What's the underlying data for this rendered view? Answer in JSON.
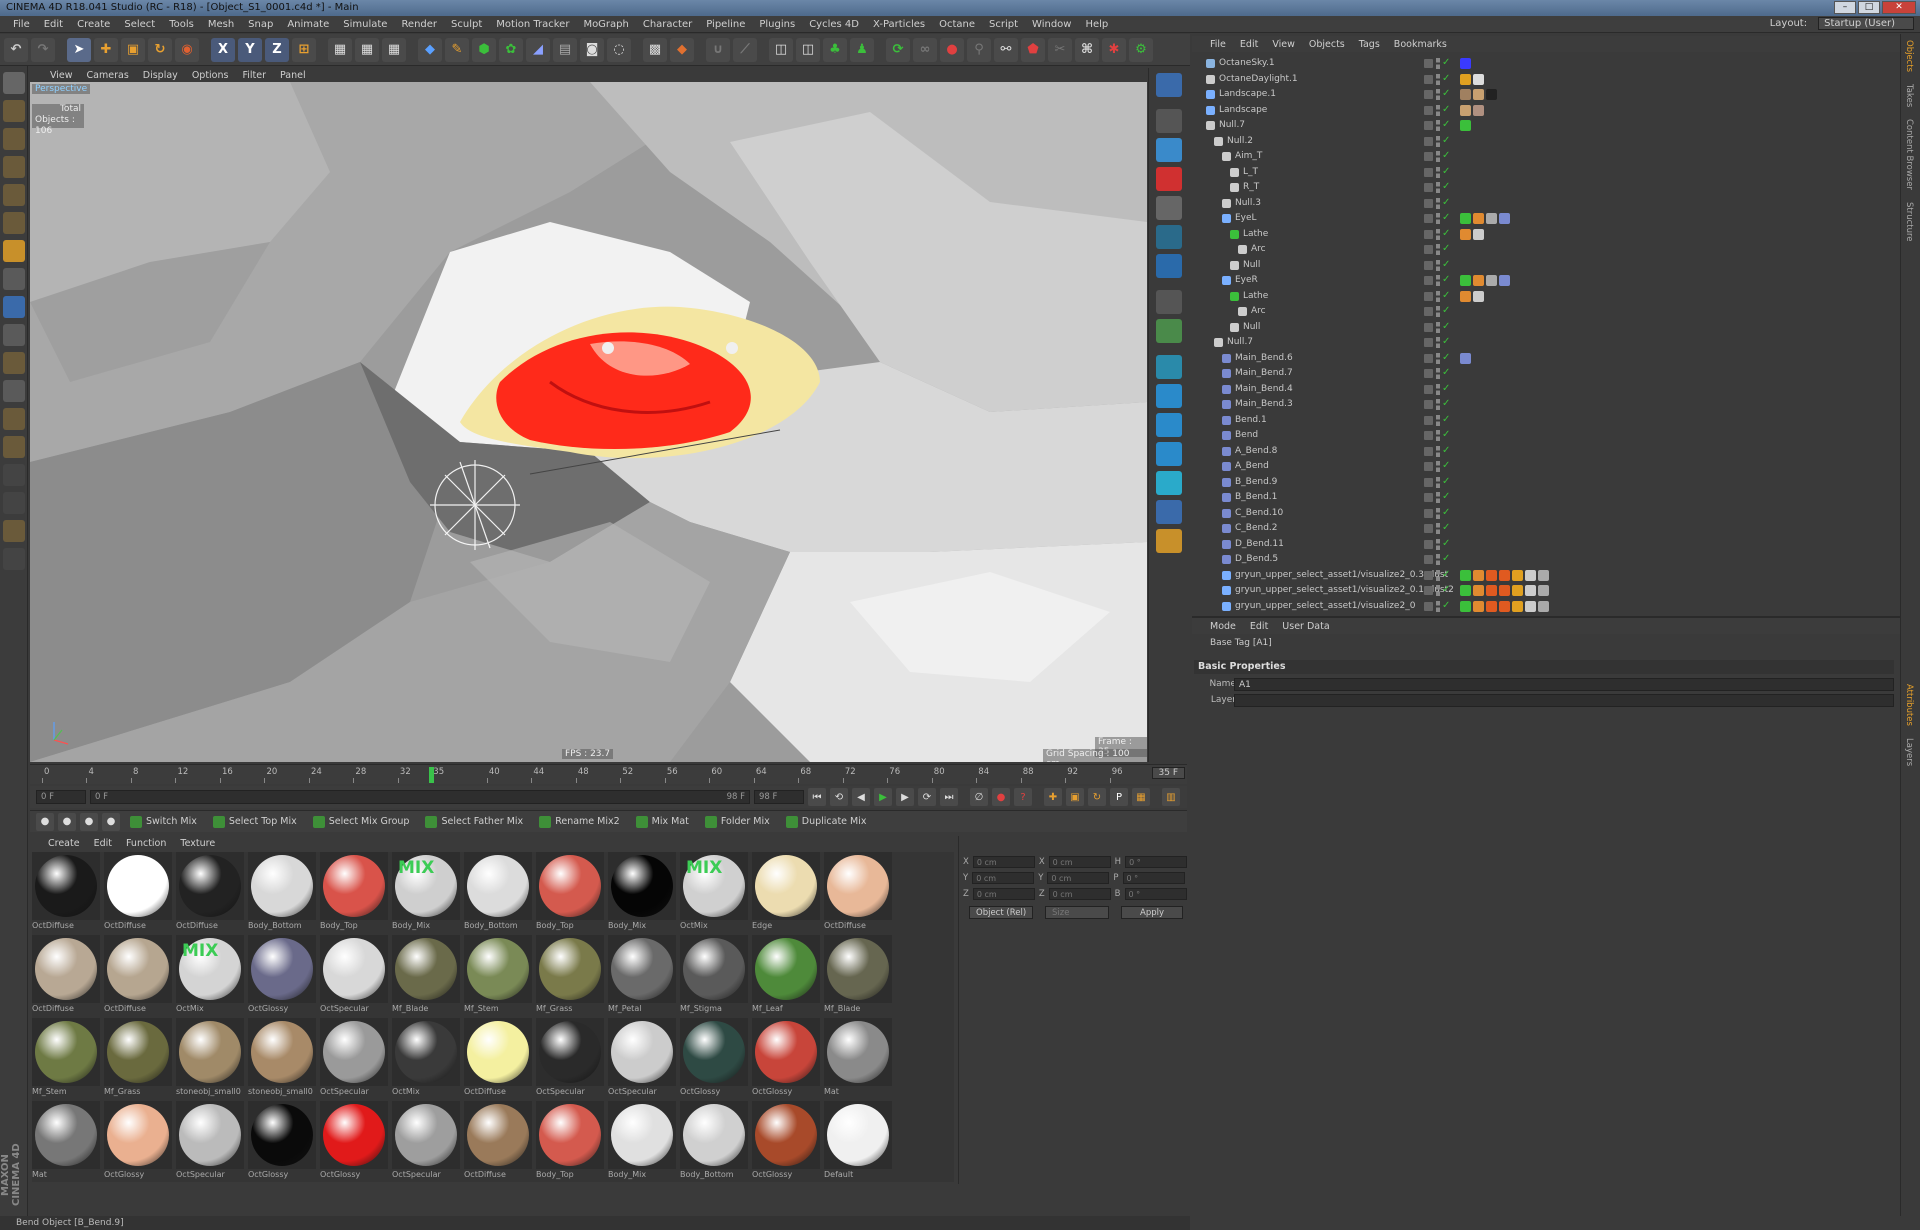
{
  "window": {
    "title": "CINEMA 4D R18.041 Studio (RC - R18) - [Object_S1_0001.c4d *] - Main"
  },
  "menubar": {
    "items": [
      "File",
      "Edit",
      "Create",
      "Select",
      "Tools",
      "Mesh",
      "Snap",
      "Animate",
      "Simulate",
      "Render",
      "Sculpt",
      "Motion Tracker",
      "MoGraph",
      "Character",
      "Pipeline",
      "Plugins",
      "Cycles 4D",
      "X-Particles",
      "Octane",
      "Script",
      "Window",
      "Help"
    ],
    "layout_label": "Layout:",
    "layout_value": "Startup (User)"
  },
  "viewport": {
    "menu": [
      "View",
      "Cameras",
      "Display",
      "Options",
      "Filter",
      "Panel"
    ],
    "camera_label": "Perspective",
    "stats_total": "Total",
    "stats_objects": "Objects : 106",
    "fps": "FPS : 23.7",
    "frame": "Frame : 35",
    "grid_spacing": "Grid Spacing : 100 cm"
  },
  "timeline": {
    "ticks": [
      "0",
      "4",
      "8",
      "12",
      "16",
      "20",
      "24",
      "28",
      "32",
      "35",
      "40",
      "44",
      "48",
      "52",
      "56",
      "60",
      "64",
      "68",
      "72",
      "76",
      "80",
      "84",
      "88",
      "92",
      "96"
    ],
    "current_frame": "35",
    "end_field": "35 F"
  },
  "transport": {
    "start_field": "0 F",
    "range_start": "0 F",
    "range_end": "98 F",
    "end_field": "98 F"
  },
  "mixbar": {
    "buttons": [
      "Switch Mix",
      "Select Top Mix",
      "Select Mix Group",
      "Select Father Mix",
      "Rename Mix2",
      "Mix Mat",
      "Folder Mix",
      "Duplicate Mix"
    ]
  },
  "material_manager": {
    "menu": [
      "Create",
      "Edit",
      "Function",
      "Texture"
    ],
    "materials": [
      {
        "name": "OctDiffuse",
        "color": "#1a1a1a",
        "mix": ""
      },
      {
        "name": "OctDiffuse",
        "color": "#ffffff",
        "mix": ""
      },
      {
        "name": "OctDiffuse",
        "color": "#222222",
        "mix": ""
      },
      {
        "name": "Body_Bottom",
        "color": "#d8d8d8",
        "mix": ""
      },
      {
        "name": "Body_Top",
        "color": "#d9534a",
        "mix": ""
      },
      {
        "name": "Body_Mix",
        "color": "#cfcfcf",
        "mix": "MIX"
      },
      {
        "name": "Body_Bottom",
        "color": "#dcdcdc",
        "mix": ""
      },
      {
        "name": "Body_Top",
        "color": "#d45a4e",
        "mix": ""
      },
      {
        "name": "Body_Mix",
        "color": "#050505",
        "mix": ""
      },
      {
        "name": "OctMix",
        "color": "#d0d0d0",
        "mix": "MIX"
      },
      {
        "name": "Edge",
        "color": "#ecdcb0",
        "mix": ""
      },
      {
        "name": "OctDiffuse",
        "color": "#e8b898",
        "mix": ""
      },
      {
        "name": "OctDiffuse",
        "color": "#b8a894",
        "mix": ""
      },
      {
        "name": "OctDiffuse",
        "color": "#b6a690",
        "mix": ""
      },
      {
        "name": "OctMix",
        "color": "#d4d4d4",
        "mix": "MIX"
      },
      {
        "name": "OctGlossy",
        "color": "#6a6a8a",
        "mix": ""
      },
      {
        "name": "OctSpecular",
        "color": "#d8d8d8",
        "mix": ""
      },
      {
        "name": "Mf_Blade",
        "color": "#6a6a4a",
        "mix": ""
      },
      {
        "name": "Mf_Stem",
        "color": "#7a8a56",
        "mix": ""
      },
      {
        "name": "Mf_Grass",
        "color": "#7a7a4a",
        "mix": ""
      },
      {
        "name": "Mf_Petal",
        "color": "#6a6a6a",
        "mix": ""
      },
      {
        "name": "Mf_Stigma",
        "color": "#5a5a5a",
        "mix": ""
      },
      {
        "name": "Mf_Leaf",
        "color": "#4e8a3a",
        "mix": ""
      },
      {
        "name": "Mf_Blade",
        "color": "#666650",
        "mix": ""
      },
      {
        "name": "Mf_Stem",
        "color": "#6e7a44",
        "mix": ""
      },
      {
        "name": "Mf_Grass",
        "color": "#6a6a3e",
        "mix": ""
      },
      {
        "name": "stoneobj_small0",
        "color": "#a08a68",
        "mix": ""
      },
      {
        "name": "stoneobj_small0",
        "color": "#a88a68",
        "mix": ""
      },
      {
        "name": "OctSpecular",
        "color": "#9a9a9a",
        "mix": ""
      },
      {
        "name": "OctMix",
        "color": "#3a3a3a",
        "mix": ""
      },
      {
        "name": "OctDiffuse",
        "color": "#f4f0a0",
        "mix": ""
      },
      {
        "name": "OctSpecular",
        "color": "#2a2a2a",
        "mix": ""
      },
      {
        "name": "OctSpecular",
        "color": "#cccccc",
        "mix": ""
      },
      {
        "name": "OctGlossy",
        "color": "#2e4a44",
        "mix": ""
      },
      {
        "name": "OctGlossy",
        "color": "#c8453a",
        "mix": ""
      },
      {
        "name": "Mat",
        "color": "#8a8a8a",
        "mix": ""
      },
      {
        "name": "Mat",
        "color": "#777777",
        "mix": ""
      },
      {
        "name": "OctGlossy",
        "color": "#eab090",
        "mix": ""
      },
      {
        "name": "OctSpecular",
        "color": "#bbbbbb",
        "mix": ""
      },
      {
        "name": "OctGlossy",
        "color": "#0a0a0a",
        "mix": ""
      },
      {
        "name": "OctGlossy",
        "color": "#e11a1a",
        "mix": ""
      },
      {
        "name": "OctSpecular",
        "color": "#9e9e9e",
        "mix": ""
      },
      {
        "name": "OctDiffuse",
        "color": "#9a7a5a",
        "mix": ""
      },
      {
        "name": "Body_Top",
        "color": "#d45a4e",
        "mix": ""
      },
      {
        "name": "Body_Mix",
        "color": "#e0e0e0",
        "mix": ""
      },
      {
        "name": "Body_Bottom",
        "color": "#d0d0d0",
        "mix": ""
      },
      {
        "name": "OctGlossy",
        "color": "#a84a2a",
        "mix": ""
      },
      {
        "name": "Default",
        "color": "#f0f0f0",
        "mix": ""
      }
    ]
  },
  "coords": {
    "rows": [
      {
        "a": "X",
        "av": "0 cm",
        "b": "X",
        "bv": "0 cm",
        "c": "H",
        "cv": "0 °"
      },
      {
        "a": "Y",
        "av": "0 cm",
        "b": "Y",
        "bv": "0 cm",
        "c": "P",
        "cv": "0 °"
      },
      {
        "a": "Z",
        "av": "0 cm",
        "b": "Z",
        "bv": "0 cm",
        "c": "B",
        "cv": "0 °"
      }
    ],
    "mode": "Object (Rel)",
    "size_mode": "Size",
    "apply": "Apply"
  },
  "object_manager": {
    "menu": [
      "File",
      "Edit",
      "View",
      "Objects",
      "Tags",
      "Bookmarks"
    ],
    "rows": [
      {
        "name": "OctaneSky.1",
        "indent": 0,
        "icon": "#8ab4e0",
        "tags": [
          "#3a3aff"
        ]
      },
      {
        "name": "OctaneDaylight.1",
        "indent": 0,
        "icon": "#cccccc",
        "tags": [
          "#e0a020",
          "#dddddd"
        ]
      },
      {
        "name": "Landscape.1",
        "indent": 0,
        "icon": "#7ab0ff",
        "tags": [
          "#a08060",
          "#c8a070",
          "#222222"
        ]
      },
      {
        "name": "Landscape",
        "indent": 0,
        "icon": "#7ab0ff",
        "tags": [
          "#c8a070",
          "#b09080"
        ]
      },
      {
        "name": "Null.7",
        "indent": 0,
        "icon": "#cccccc",
        "tags": [
          "#3bbf3b"
        ]
      },
      {
        "name": "Null.2",
        "indent": 1,
        "icon": "#cccccc",
        "tags": []
      },
      {
        "name": "Aim_T",
        "indent": 2,
        "icon": "#cccccc",
        "tags": []
      },
      {
        "name": "L_T",
        "indent": 3,
        "icon": "#cccccc",
        "tags": []
      },
      {
        "name": "R_T",
        "indent": 3,
        "icon": "#cccccc",
        "tags": []
      },
      {
        "name": "Null.3",
        "indent": 2,
        "icon": "#cccccc",
        "tags": []
      },
      {
        "name": "EyeL",
        "indent": 2,
        "icon": "#7ab0ff",
        "tags": [
          "#3bbf3b",
          "#e08a30",
          "#aaaaaa",
          "#7a8ad0"
        ]
      },
      {
        "name": "Lathe",
        "indent": 3,
        "icon": "#3bbf3b",
        "tags": [
          "#e08a30",
          "#cccccc"
        ]
      },
      {
        "name": "Arc",
        "indent": 4,
        "icon": "#cccccc",
        "tags": []
      },
      {
        "name": "Null",
        "indent": 3,
        "icon": "#cccccc",
        "tags": []
      },
      {
        "name": "EyeR",
        "indent": 2,
        "icon": "#7ab0ff",
        "tags": [
          "#3bbf3b",
          "#e08a30",
          "#aaaaaa",
          "#7a8ad0"
        ]
      },
      {
        "name": "Lathe",
        "indent": 3,
        "icon": "#3bbf3b",
        "tags": [
          "#e08a30",
          "#cccccc"
        ]
      },
      {
        "name": "Arc",
        "indent": 4,
        "icon": "#cccccc",
        "tags": []
      },
      {
        "name": "Null",
        "indent": 3,
        "icon": "#cccccc",
        "tags": []
      },
      {
        "name": "Null.7",
        "indent": 1,
        "icon": "#cccccc",
        "tags": []
      },
      {
        "name": "Main_Bend.6",
        "indent": 2,
        "icon": "#7a8ad0",
        "tags": [
          "#7a8ad0"
        ]
      },
      {
        "name": "Main_Bend.7",
        "indent": 2,
        "icon": "#7a8ad0",
        "tags": []
      },
      {
        "name": "Main_Bend.4",
        "indent": 2,
        "icon": "#7a8ad0",
        "tags": []
      },
      {
        "name": "Main_Bend.3",
        "indent": 2,
        "icon": "#7a8ad0",
        "tags": []
      },
      {
        "name": "Bend.1",
        "indent": 2,
        "icon": "#7a8ad0",
        "tags": []
      },
      {
        "name": "Bend",
        "indent": 2,
        "icon": "#7a8ad0",
        "tags": []
      },
      {
        "name": "A_Bend.8",
        "indent": 2,
        "icon": "#7a8ad0",
        "tags": []
      },
      {
        "name": "A_Bend",
        "indent": 2,
        "icon": "#7a8ad0",
        "tags": []
      },
      {
        "name": "B_Bend.9",
        "indent": 2,
        "icon": "#7a8ad0",
        "tags": []
      },
      {
        "name": "B_Bend.1",
        "indent": 2,
        "icon": "#7a8ad0",
        "tags": []
      },
      {
        "name": "C_Bend.10",
        "indent": 2,
        "icon": "#7a8ad0",
        "tags": []
      },
      {
        "name": "C_Bend.2",
        "indent": 2,
        "icon": "#7a8ad0",
        "tags": []
      },
      {
        "name": "D_Bend.11",
        "indent": 2,
        "icon": "#7a8ad0",
        "tags": []
      },
      {
        "name": "D_Bend.5",
        "indent": 2,
        "icon": "#7a8ad0",
        "tags": []
      },
      {
        "name": "gryun_upper_select_asset1/visualize2_0.3_dust",
        "indent": 2,
        "icon": "#7ab0ff",
        "tags": [
          "#3bbf3b",
          "#e08a30",
          "#e05a20",
          "#e05a20",
          "#e0a020",
          "#cccccc",
          "#aaaaaa"
        ]
      },
      {
        "name": "gryun_upper_select_asset1/visualize2_0.1_dust2",
        "indent": 2,
        "icon": "#7ab0ff",
        "tags": [
          "#3bbf3b",
          "#e08a30",
          "#e05a20",
          "#e05a20",
          "#e0a020",
          "#cccccc",
          "#aaaaaa"
        ]
      },
      {
        "name": "gryun_upper_select_asset1/visualize2_0",
        "indent": 2,
        "icon": "#7ab0ff",
        "tags": [
          "#3bbf3b",
          "#e08a30",
          "#e05a20",
          "#e05a20",
          "#e0a020",
          "#cccccc",
          "#aaaaaa"
        ]
      }
    ]
  },
  "attribute_manager": {
    "menu": [
      "Mode",
      "Edit",
      "User Data"
    ],
    "title": "Base Tag [A1]",
    "section": "Basic Properties",
    "name_label": "Name",
    "name_value": "A1",
    "layer_label": "Layer",
    "layer_value": ""
  },
  "status": {
    "text": "Bend Object [B_Bend.9]"
  },
  "righttabs": [
    "Objects",
    "Takes",
    "Content Browser",
    "Structure",
    "Attributes",
    "Layers"
  ],
  "brand": "MAXON CINEMA 4D"
}
